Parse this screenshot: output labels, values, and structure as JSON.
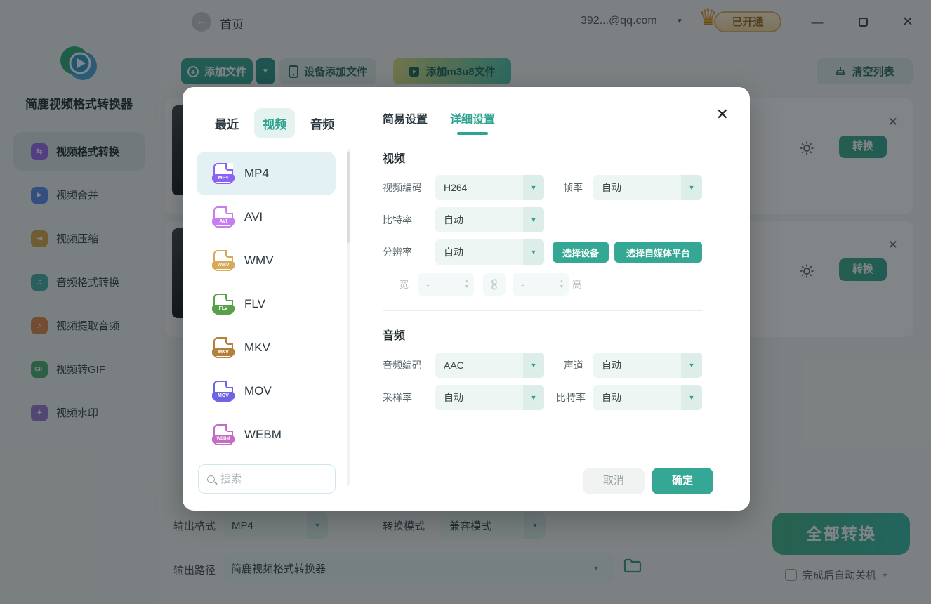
{
  "colors": {
    "accent": "#35a795",
    "vip_gold": "#e2b269",
    "overlay": "rgba(16,22,24,0.52)"
  },
  "topbar": {
    "home": "首页",
    "account": "392...@qq.com",
    "vip_status": "已开通"
  },
  "toolbar": {
    "add_file": "添加文件",
    "add_from_device": "设备添加文件",
    "add_m3u8": "添加m3u8文件",
    "clear_list": "清空列表"
  },
  "sidebar": {
    "title": "简鹿视频格式转换器",
    "items": [
      {
        "label": "视频格式转换",
        "icon": "video-convert-icon",
        "glyph": "⇆",
        "color": "#9b6cf0",
        "active": true
      },
      {
        "label": "视频合并",
        "icon": "video-merge-icon",
        "glyph": "▶",
        "color": "#5b8def",
        "active": false
      },
      {
        "label": "视频压缩",
        "icon": "video-compress-icon",
        "glyph": "⇥",
        "color": "#d9a94e",
        "active": false
      },
      {
        "label": "音频格式转换",
        "icon": "audio-convert-icon",
        "glyph": "♫",
        "color": "#45b0a8",
        "active": false
      },
      {
        "label": "视频提取音频",
        "icon": "extract-audio-icon",
        "glyph": "♪",
        "color": "#e08a4e",
        "active": false
      },
      {
        "label": "视频转GIF",
        "icon": "video-to-gif-icon",
        "glyph": "GIF",
        "color": "#4caf72",
        "active": false
      },
      {
        "label": "视频水印",
        "icon": "watermark-icon",
        "glyph": "✦",
        "color": "#9b7bd8",
        "active": false
      }
    ]
  },
  "file_cards": {
    "convert_label": "转换"
  },
  "bottom": {
    "output_format_label": "输出格式",
    "output_format": "MP4",
    "mode_label": "转换模式",
    "mode": "兼容模式",
    "output_path_label": "输出路径",
    "output_path": "简鹿视频格式转换器",
    "convert_all": "全部转换",
    "auto_shutdown": "完成后自动关机"
  },
  "modal": {
    "format_panel": {
      "tabs": [
        {
          "label": "最近"
        },
        {
          "label": "视频"
        },
        {
          "label": "音频"
        }
      ],
      "active_tab": "视频",
      "selected_format": "MP4",
      "formats": [
        {
          "name": "MP4",
          "color": "#8a63f2"
        },
        {
          "name": "AVI",
          "color": "#c77df0"
        },
        {
          "name": "WMV",
          "color": "#d8a958"
        },
        {
          "name": "FLV",
          "color": "#58a04c"
        },
        {
          "name": "MKV",
          "color": "#b5803c"
        },
        {
          "name": "MOV",
          "color": "#6f63e8"
        },
        {
          "name": "WEBM",
          "color": "#c46cc4"
        }
      ],
      "search_placeholder": "搜索"
    },
    "settings": {
      "tab_simple": "简易设置",
      "tab_detailed": "详细设置",
      "active_tab": "详细设置",
      "video": {
        "heading": "视频",
        "encode_label": "视频编码",
        "encode_value": "H264",
        "fps_label": "帧率",
        "fps_value": "自动",
        "bitrate_label": "比特率",
        "bitrate_value": "自动",
        "resolution_label": "分辨率",
        "resolution_value": "自动",
        "select_device": "选择设备",
        "select_platform": "选择自媒体平台",
        "width_label": "宽",
        "width_value": "-",
        "height_label": "高",
        "height_value": "-"
      },
      "audio": {
        "heading": "音频",
        "encode_label": "音频编码",
        "encode_value": "AAC",
        "channel_label": "声道",
        "channel_value": "自动",
        "sample_label": "采样率",
        "sample_value": "自动",
        "bitrate_label": "比特率",
        "bitrate_value": "自动"
      },
      "cancel": "取消",
      "ok": "确定"
    }
  }
}
